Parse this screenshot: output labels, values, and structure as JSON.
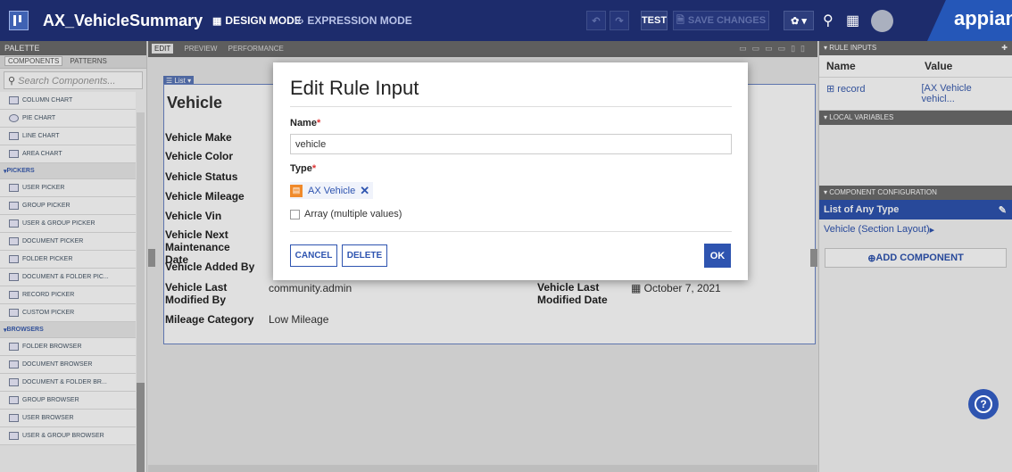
{
  "topbar": {
    "app_title": "AX_VehicleSummary",
    "design_mode": "DESIGN MODE",
    "expression_mode": "EXPRESSION MODE",
    "test_label": "TEST",
    "save_label": "SAVE CHANGES",
    "brand": "appian"
  },
  "palette": {
    "title": "PALETTE",
    "tabs": [
      "COMPONENTS",
      "PATTERNS"
    ],
    "search_placeholder": "Search Components...",
    "items_charts": [
      "COLUMN CHART",
      "PIE CHART",
      "LINE CHART",
      "AREA CHART"
    ],
    "section_pickers": "PICKERS",
    "items_pickers": [
      "USER PICKER",
      "GROUP PICKER",
      "USER & GROUP PICKER",
      "DOCUMENT PICKER",
      "FOLDER PICKER",
      "DOCUMENT & FOLDER PIC...",
      "RECORD PICKER",
      "CUSTOM PICKER"
    ],
    "section_browsers": "BROWSERS",
    "items_browsers": [
      "FOLDER BROWSER",
      "DOCUMENT BROWSER",
      "DOCUMENT & FOLDER BR...",
      "GROUP BROWSER",
      "USER BROWSER",
      "USER & GROUP BROWSER"
    ]
  },
  "canvas": {
    "tabs": [
      "EDIT",
      "PREVIEW",
      "PERFORMANCE"
    ],
    "list_tag": "List",
    "section_title": "Vehicle",
    "labels": [
      "Vehicle Make",
      "Vehicle Color",
      "Vehicle Status",
      "Vehicle Mileage",
      "Vehicle Vin",
      "Vehicle Next Maintenance Date",
      "Vehicle Added By",
      "Vehicle Last Modified By",
      "Mileage Category"
    ],
    "value_last_modified_by": "community.admin",
    "value_mileage_category": "Low Mileage",
    "right_label": "Vehicle Last Modified Date",
    "right_value": "October 7, 2021"
  },
  "right_panel": {
    "rule_inputs_title": "RULE INPUTS",
    "col_name": "Name",
    "col_value": "Value",
    "row_name": "record",
    "row_value": "[AX Vehicle vehicl...",
    "local_vars_title": "LOCAL VARIABLES",
    "component_config_title": "COMPONENT CONFIGURATION",
    "cc_selected": "List of Any Type",
    "cc_child": "Vehicle (Section Layout)",
    "add_component": "ADD COMPONENT"
  },
  "modal": {
    "title": "Edit Rule Input",
    "name_label": "Name",
    "name_value": "vehicle",
    "type_label": "Type",
    "type_chip": "AX Vehicle",
    "array_label": "Array (multiple values)",
    "cancel": "CANCEL",
    "delete": "DELETE",
    "ok": "OK",
    "required_mark": "*"
  }
}
